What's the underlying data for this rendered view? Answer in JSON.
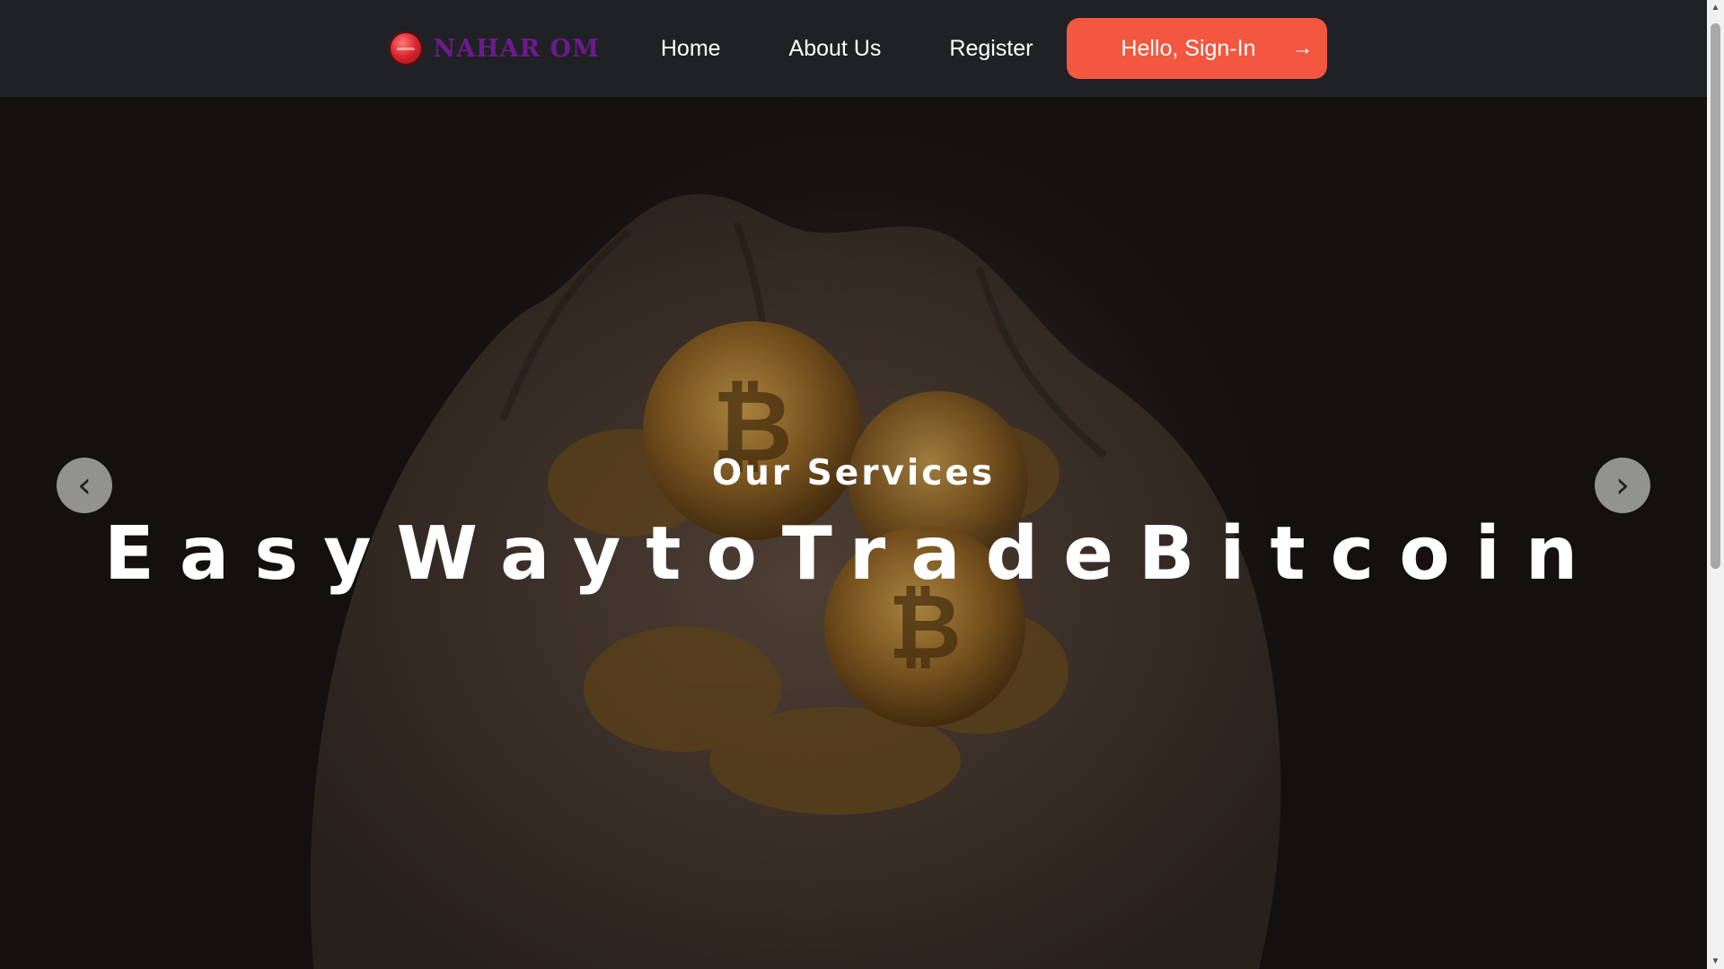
{
  "navbar": {
    "logo_text": "NAHAR OM",
    "links": [
      {
        "label": "Home"
      },
      {
        "label": "About Us"
      },
      {
        "label": "Register"
      }
    ],
    "signin": {
      "label": "Hello, Sign-In",
      "arrow": "→"
    }
  },
  "hero": {
    "subtitle": "Our Services",
    "title": "EasyWaytoTradeBitcoin",
    "prev_glyph": "‹",
    "next_glyph": "›"
  },
  "colors": {
    "navbar_bg": "#202124",
    "accent": "#f3573f",
    "logo_text": "#6d1a8e"
  },
  "icons": {
    "logo": "red-coin-logo-icon",
    "signin_arrow": "arrow-right-icon",
    "prev": "chevron-left-icon",
    "next": "chevron-right-icon"
  }
}
